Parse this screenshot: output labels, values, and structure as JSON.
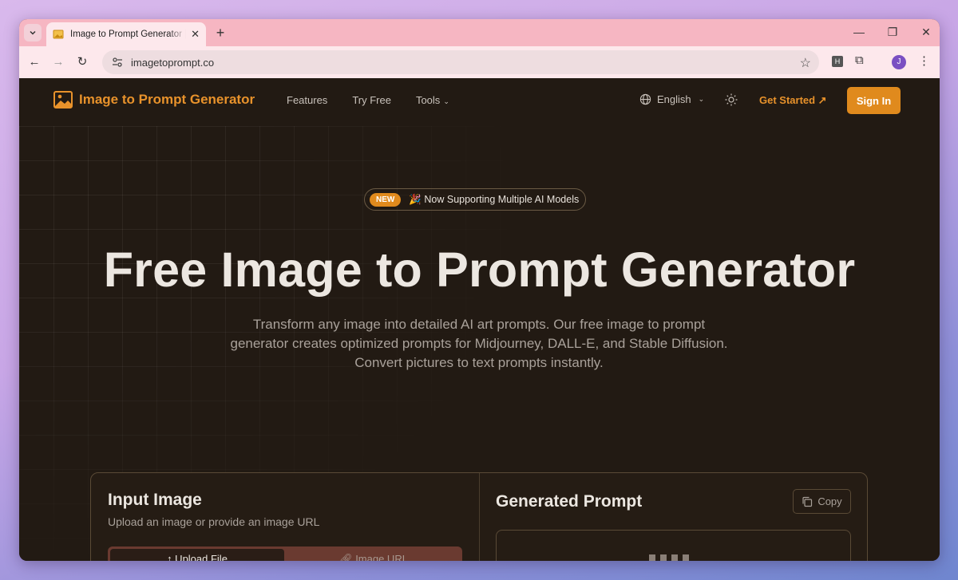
{
  "browser": {
    "tab_title": "Image to Prompt Generator | Turn Images into AI Prompts",
    "url": "imagetoprompt.co",
    "profile_initial": "J",
    "extension_label": "H"
  },
  "nav": {
    "brand": "Image to Prompt Generator",
    "links": [
      "Features",
      "Try Free",
      "Tools"
    ],
    "language": "English",
    "get_started": "Get Started ↗",
    "sign_in": "Sign In"
  },
  "hero": {
    "badge_tag": "NEW",
    "badge_text": "🎉 Now Supporting Multiple AI Models",
    "title": "Free Image to Prompt Generator",
    "subtitle_line1": "Transform any image into detailed AI art prompts. Our free image to prompt generator creates optimized prompts for Midjourney, DALL-E, and Stable Diffusion.",
    "subtitle_line2": "Convert pictures to text prompts instantly."
  },
  "input_panel": {
    "title": "Input Image",
    "subtitle": "Upload an image or provide an image URL",
    "tab_upload": "↑  Upload File",
    "tab_url": "Image URL"
  },
  "output_panel": {
    "title": "Generated Prompt",
    "copy_label": "Copy"
  },
  "colors": {
    "accent": "#e08a1d",
    "page_bg": "#221a13",
    "tabstrip_bg": "#f6b6c2"
  }
}
